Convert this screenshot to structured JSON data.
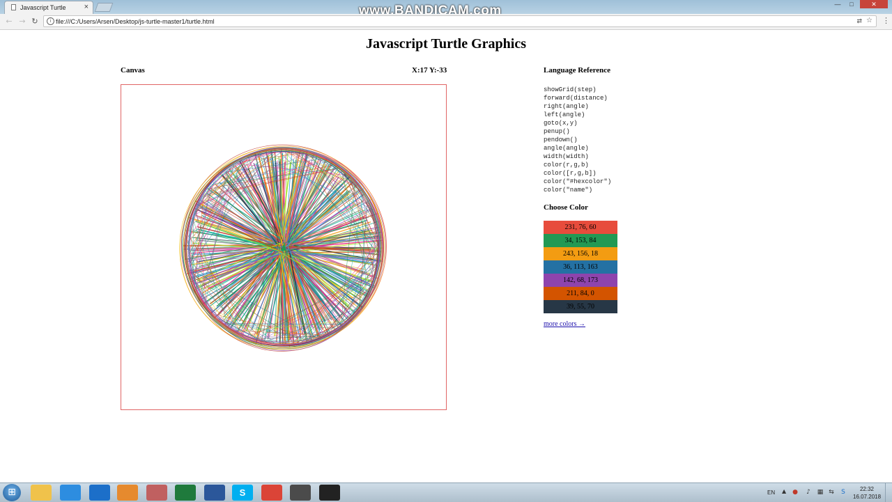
{
  "browser": {
    "tab_title": "Javascript Turtle",
    "tab_close": "×",
    "url": "file:///C:/Users/Arsen/Desktop/js-turtle-master1/turtle.html",
    "nav_back": "←",
    "nav_forward": "→",
    "nav_reload": "↻",
    "star": "☆",
    "menu": "⋮",
    "window_min": "—",
    "window_max": "□",
    "window_close": "✕"
  },
  "watermark": "www.BANDICAM.com",
  "page": {
    "title": "Javascript Turtle Graphics",
    "canvas_label": "Canvas",
    "coords": "X:17 Y:-33",
    "language_reference_title": "Language Reference",
    "commands": [
      "showGrid(step)",
      "forward(distance)",
      "right(angle)",
      "left(angle)",
      "goto(x,y)",
      "penup()",
      "pendown()",
      "angle(angle)",
      "width(width)",
      "color(r,g,b)",
      "color([r,g,b])",
      "color(\"#hexcolor\")",
      "color(\"name\")"
    ],
    "choose_color_title": "Choose Color",
    "swatches": [
      {
        "label": "231, 76, 60",
        "color": "#e74c3c"
      },
      {
        "label": "34, 153, 84",
        "color": "#229954"
      },
      {
        "label": "243, 156, 18",
        "color": "#f39c12"
      },
      {
        "label": "36, 113, 163",
        "color": "#2471a3"
      },
      {
        "label": "142, 68, 173",
        "color": "#8e44ad"
      },
      {
        "label": "211, 84, 0",
        "color": "#d35400"
      },
      {
        "label": "39, 55, 70",
        "color": "#273746"
      }
    ],
    "more_colors": "more colors →",
    "drawing_palette": [
      "#e74c3c",
      "#229954",
      "#f39c12",
      "#2471a3",
      "#8e44ad",
      "#d35400",
      "#273746",
      "#e91e8c",
      "#1abc9c",
      "#9b59b6",
      "#f1c40f",
      "#3498db",
      "#7f8c8d",
      "#c0392b",
      "#16a085",
      "#a3e635"
    ]
  },
  "taskbar": {
    "start_icon": "windows-start-icon",
    "apps": [
      {
        "name": "explorer-icon",
        "color": "#f0c24b"
      },
      {
        "name": "ie-icon",
        "color": "#2d8de0"
      },
      {
        "name": "teamviewer-icon",
        "color": "#1c6fc9"
      },
      {
        "name": "media-player-icon",
        "color": "#e68a2e"
      },
      {
        "name": "paint-icon",
        "color": "#c06060"
      },
      {
        "name": "excel-icon",
        "color": "#1f7a3c"
      },
      {
        "name": "word-icon",
        "color": "#2b579a"
      },
      {
        "name": "skype-icon",
        "color": "#00aff0"
      },
      {
        "name": "chrome-icon",
        "color": "#db4437"
      },
      {
        "name": "sublime-icon",
        "color": "#4b4b4b"
      },
      {
        "name": "bandicam-icon",
        "color": "#222222"
      }
    ],
    "skype_letter": "S",
    "language": "EN",
    "tray_arrow": "▲",
    "time": "22:32",
    "date": "16.07.2018"
  }
}
